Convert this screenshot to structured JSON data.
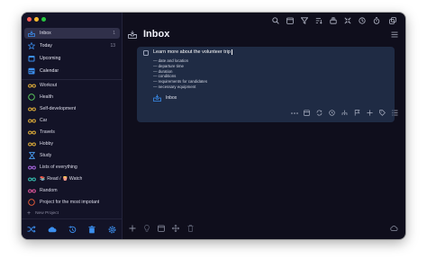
{
  "colors": {
    "accent": "#3b8fef",
    "sidebar_bg": "#131327",
    "main_bg": "#0f0e1c",
    "card_bg": "#1f2b44"
  },
  "sidebar": {
    "nav": [
      {
        "label": "Inbox",
        "count": "1",
        "icon": "inbox-icon"
      },
      {
        "label": "Today",
        "count": "13",
        "icon": "star-icon"
      },
      {
        "label": "Upcoming",
        "count": "",
        "icon": "calendar-icon"
      },
      {
        "label": "Calendar",
        "count": "",
        "icon": "calendar-grid-icon"
      }
    ],
    "projects": [
      {
        "label": "Workout",
        "icon": "infinity-icon",
        "color": "#e8b43a"
      },
      {
        "label": "Health",
        "icon": "circle-icon",
        "color": "#5fd35f"
      },
      {
        "label": "Self-development",
        "icon": "infinity-icon",
        "color": "#e8b43a"
      },
      {
        "label": "Car",
        "icon": "infinity-icon",
        "color": "#e8b43a"
      },
      {
        "label": "Travels",
        "icon": "infinity-icon",
        "color": "#e8b43a"
      },
      {
        "label": "Hobby",
        "icon": "infinity-icon",
        "color": "#e8b43a"
      },
      {
        "label": "Study",
        "icon": "hourglass-icon",
        "color": "#4a9cf0"
      },
      {
        "label": "Lists of everything",
        "icon": "infinity-icon",
        "color": "#b06ae8"
      },
      {
        "label": "Read / Watch",
        "icon": "infinity-icon",
        "color": "#38c8b8",
        "emoji_read": "📚",
        "emoji_watch": "🍿"
      },
      {
        "label": "Random",
        "icon": "infinity-icon",
        "color": "#e85aa0"
      },
      {
        "label": "Project for the most impotant",
        "icon": "circle-icon",
        "color": "#f0603a"
      }
    ],
    "new_project": "New Project",
    "bottom_icons": [
      "shuffle-icon",
      "cloud-icon",
      "history-icon",
      "trash-icon",
      "settings-icon"
    ]
  },
  "header": {
    "title": "Inbox",
    "icons": [
      "search-icon",
      "calendar-icon",
      "filter-icon",
      "sort-icon",
      "stack-icon",
      "collapse-icon",
      "clock-icon",
      "timer-icon",
      "copy-icon"
    ],
    "menu_icon": "menu-icon"
  },
  "task": {
    "title": "Learn more about the volunteer trip",
    "notes": [
      "— date and location",
      "— departure time",
      "— duration",
      "— conditions",
      "— requirements for candidates",
      "— necessary equipment"
    ],
    "list_label": "Inbox",
    "actions": [
      "more-icon",
      "date-icon",
      "repeat-icon",
      "alarm-icon",
      "subtask-icon",
      "flag-icon",
      "move-icon",
      "tag-icon",
      "checklist-icon"
    ]
  },
  "bottom_bar": {
    "icons": [
      "add-icon",
      "lightbulb-icon",
      "calendar-icon",
      "move-icon",
      "trash-icon"
    ],
    "right_icon": "cloud-icon"
  }
}
